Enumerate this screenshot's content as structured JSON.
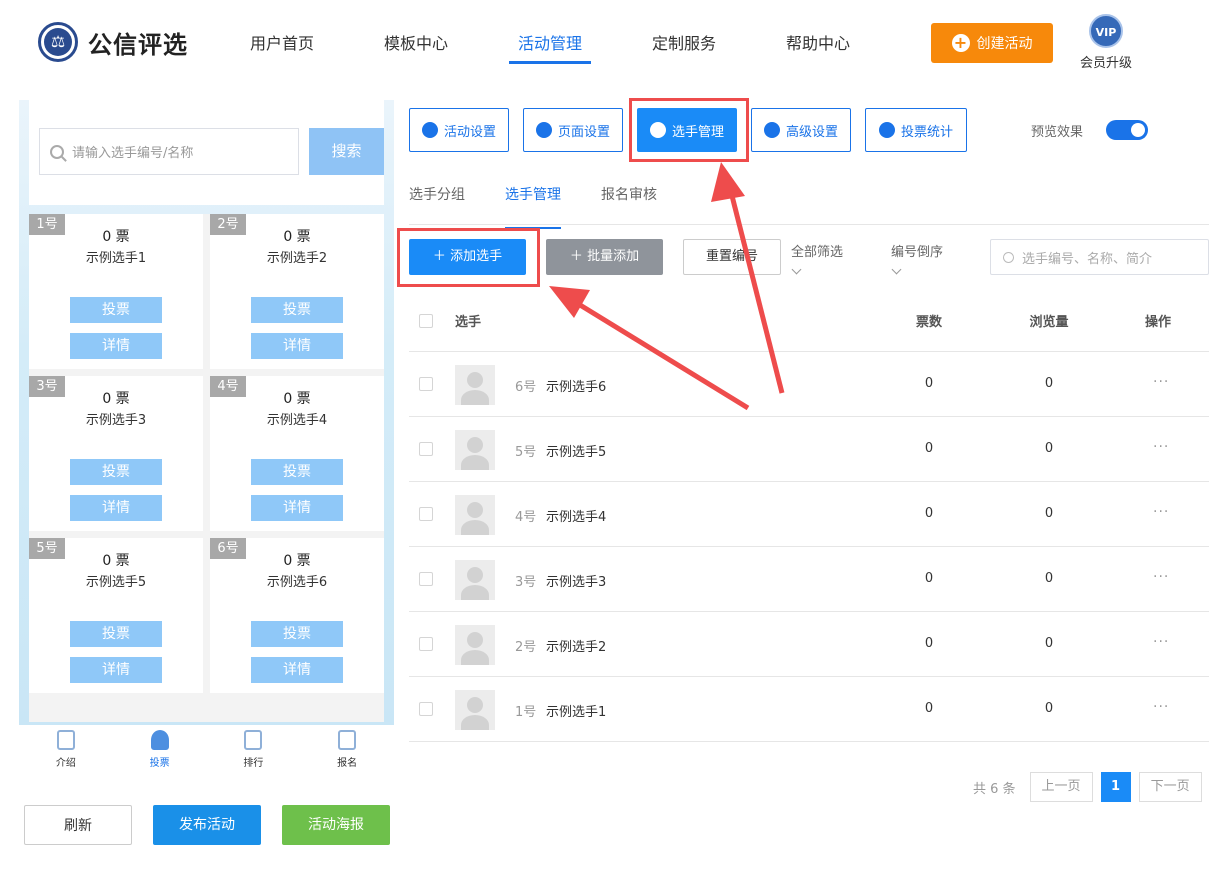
{
  "header": {
    "logo_text": "公信评选",
    "nav": [
      "用户首页",
      "模板中心",
      "活动管理",
      "定制服务",
      "帮助中心"
    ],
    "create_label": "创建活动",
    "vip_badge": "VIP",
    "vip_label": "会员升级"
  },
  "preview": {
    "search_placeholder": "请输入选手编号/名称",
    "search_button": "搜索",
    "vote_unit": "0 票",
    "cards": [
      {
        "no": "1号",
        "votes": "0 票",
        "name": "示例选手1",
        "vote": "投票",
        "detail": "详情"
      },
      {
        "no": "2号",
        "votes": "0 票",
        "name": "示例选手2",
        "vote": "投票",
        "detail": "详情"
      },
      {
        "no": "3号",
        "votes": "0 票",
        "name": "示例选手3",
        "vote": "投票",
        "detail": "详情"
      },
      {
        "no": "4号",
        "votes": "0 票",
        "name": "示例选手4",
        "vote": "投票",
        "detail": "详情"
      },
      {
        "no": "5号",
        "votes": "0 票",
        "name": "示例选手5",
        "vote": "投票",
        "detail": "详情"
      },
      {
        "no": "6号",
        "votes": "0 票",
        "name": "示例选手6",
        "vote": "投票",
        "detail": "详情"
      }
    ],
    "tabs": [
      "介绍",
      "投票",
      "排行",
      "报名"
    ]
  },
  "bottom_buttons": {
    "refresh": "刷新",
    "publish": "发布活动",
    "poster": "活动海报"
  },
  "toolbar": {
    "buttons": [
      "活动设置",
      "页面设置",
      "选手管理",
      "高级设置",
      "投票统计"
    ],
    "preview_label": "预览效果"
  },
  "subtabs": [
    "选手分组",
    "选手管理",
    "报名审核"
  ],
  "actions": {
    "add": "添加选手",
    "batch": "批量添加",
    "reset": "重置编号",
    "filter_all": "全部筛选",
    "filter_sort": "编号倒序",
    "search_placeholder": "选手编号、名称、简介"
  },
  "table": {
    "headers": {
      "player": "选手",
      "votes": "票数",
      "views": "浏览量",
      "ops": "操作"
    },
    "rows": [
      {
        "num": "6号",
        "name": "示例选手6",
        "votes": "0",
        "views": "0",
        "more": "···"
      },
      {
        "num": "5号",
        "name": "示例选手5",
        "votes": "0",
        "views": "0",
        "more": "···"
      },
      {
        "num": "4号",
        "name": "示例选手4",
        "votes": "0",
        "views": "0",
        "more": "···"
      },
      {
        "num": "3号",
        "name": "示例选手3",
        "votes": "0",
        "views": "0",
        "more": "···"
      },
      {
        "num": "2号",
        "name": "示例选手2",
        "votes": "0",
        "views": "0",
        "more": "···"
      },
      {
        "num": "1号",
        "name": "示例选手1",
        "votes": "0",
        "views": "0",
        "more": "···"
      }
    ]
  },
  "pager": {
    "total": "共 6 条",
    "prev": "上一页",
    "current": "1",
    "next": "下一页"
  },
  "colors": {
    "accent": "#1a8bf7",
    "orange": "#f7890b",
    "annotation": "#ee4c4c",
    "green": "#6ec04b"
  }
}
